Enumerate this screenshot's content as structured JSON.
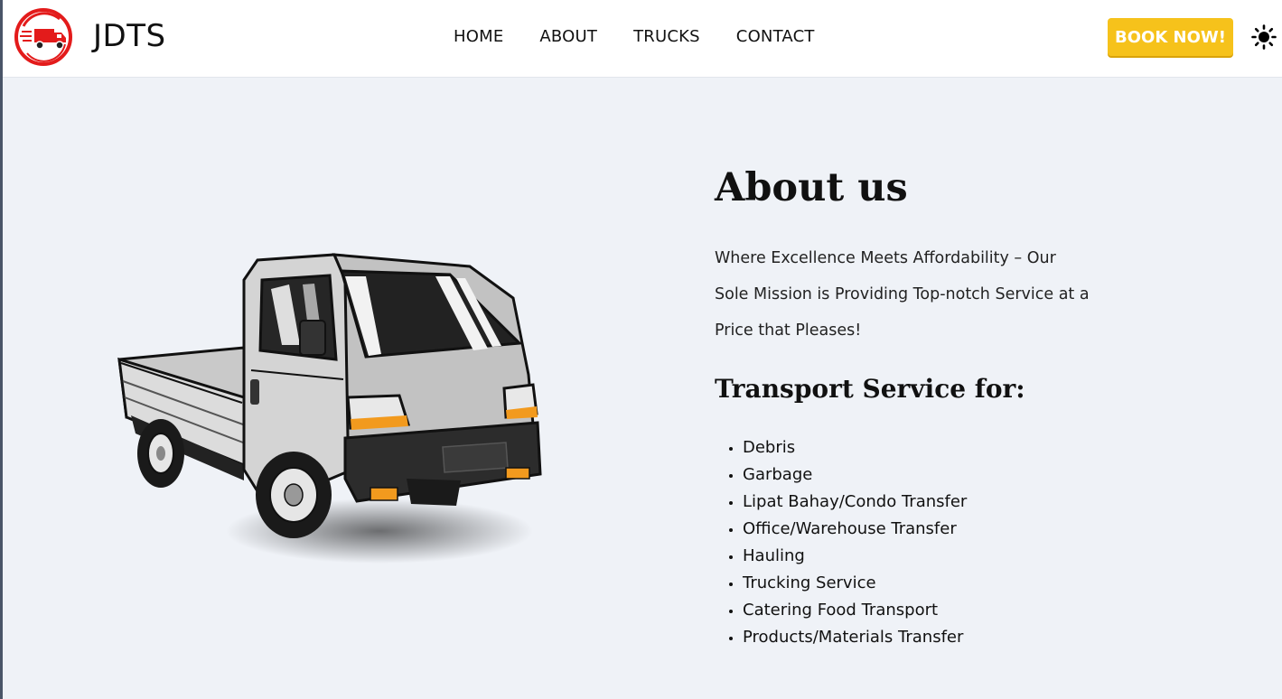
{
  "header": {
    "brand": "JDTS",
    "logo_icon": "truck-logo-icon",
    "nav": [
      "HOME",
      "ABOUT",
      "TRUCKS",
      "CONTACT"
    ],
    "book_label": "BOOK NOW!",
    "theme_icon": "sun-icon"
  },
  "about": {
    "title": "About us",
    "tagline": "Where Excellence Meets Affordability – Our Sole Mission is Providing Top-notch Service at a Price that Pleases!",
    "services_heading": "Transport Service for:",
    "services": [
      "Debris",
      "Garbage",
      "Lipat Bahay/Condo Transfer",
      "Office/Warehouse Transfer",
      "Hauling",
      "Trucking Service",
      "Catering Food Transport",
      "Products/Materials Transfer"
    ]
  },
  "colors": {
    "accent": "#f6c21b",
    "logo_red": "#e31b1b",
    "background": "#eff2f7"
  }
}
